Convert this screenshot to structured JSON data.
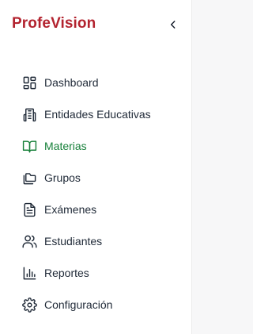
{
  "app": {
    "brand": "ProfeVision",
    "brand_color": "#b3232f",
    "accent_active": "#17803a"
  },
  "header": {
    "collapse_icon": "chevron-left-icon"
  },
  "sidebar": {
    "items": [
      {
        "label": "Dashboard",
        "icon": "layout-grid-icon",
        "active": false
      },
      {
        "label": "Entidades Educativas",
        "icon": "building-icon",
        "active": false
      },
      {
        "label": "Materias",
        "icon": "book-open-icon",
        "active": true
      },
      {
        "label": "Grupos",
        "icon": "folders-icon",
        "active": false
      },
      {
        "label": "Exámenes",
        "icon": "file-text-icon",
        "active": false
      },
      {
        "label": "Estudiantes",
        "icon": "users-icon",
        "active": false
      },
      {
        "label": "Reportes",
        "icon": "bar-chart-icon",
        "active": false
      },
      {
        "label": "Configuración",
        "icon": "gear-icon",
        "active": false
      }
    ]
  }
}
